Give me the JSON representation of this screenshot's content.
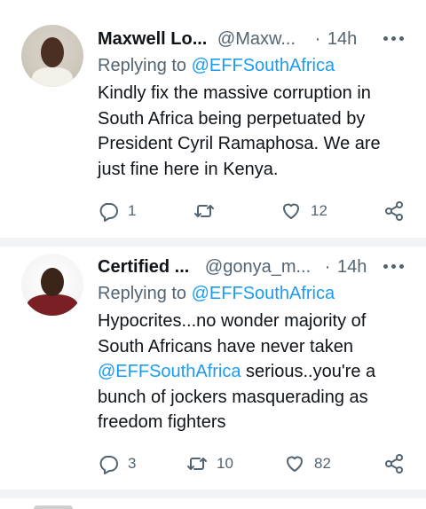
{
  "tweets": [
    {
      "name": "Maxwell Lo...",
      "handle": "@Maxw...",
      "dot": "·",
      "time": "14h",
      "replying_label": "Replying to",
      "replying_handle": "@EFFSouthAfrica",
      "text_lines": [
        "Kindly fix the massive corruption in",
        "South Africa being perpetuated by",
        "President Cyril Ramaphosa. We are",
        "just fine here in Kenya."
      ],
      "replies": "1",
      "retweets": "",
      "likes": "12"
    },
    {
      "name": "Certified ...",
      "handle": "@gonya_m...",
      "dot": "·",
      "time": "14h",
      "replying_label": "Replying to",
      "replying_handle": "@EFFSouthAfrica",
      "text_line1": "Hypocrites...no wonder majority of",
      "text_line2": "South Africans have never taken",
      "text_line3_mention": "@EFFSouthAfrica",
      "text_line3_rest": " serious..you're a",
      "text_line4": "bunch of jockers masquerading as",
      "text_line5": "freedom fighters",
      "replies": "3",
      "retweets": "10",
      "likes": "82"
    }
  ],
  "icons": {
    "reply": "reply-icon",
    "retweet": "retweet-icon",
    "like": "heart-icon",
    "share": "share-icon",
    "more": "more-options-icon"
  },
  "colors": {
    "text": "#0f1419",
    "secondary": "#536471",
    "mention": "#1d9bf0",
    "divider": "#f2f3f4"
  }
}
